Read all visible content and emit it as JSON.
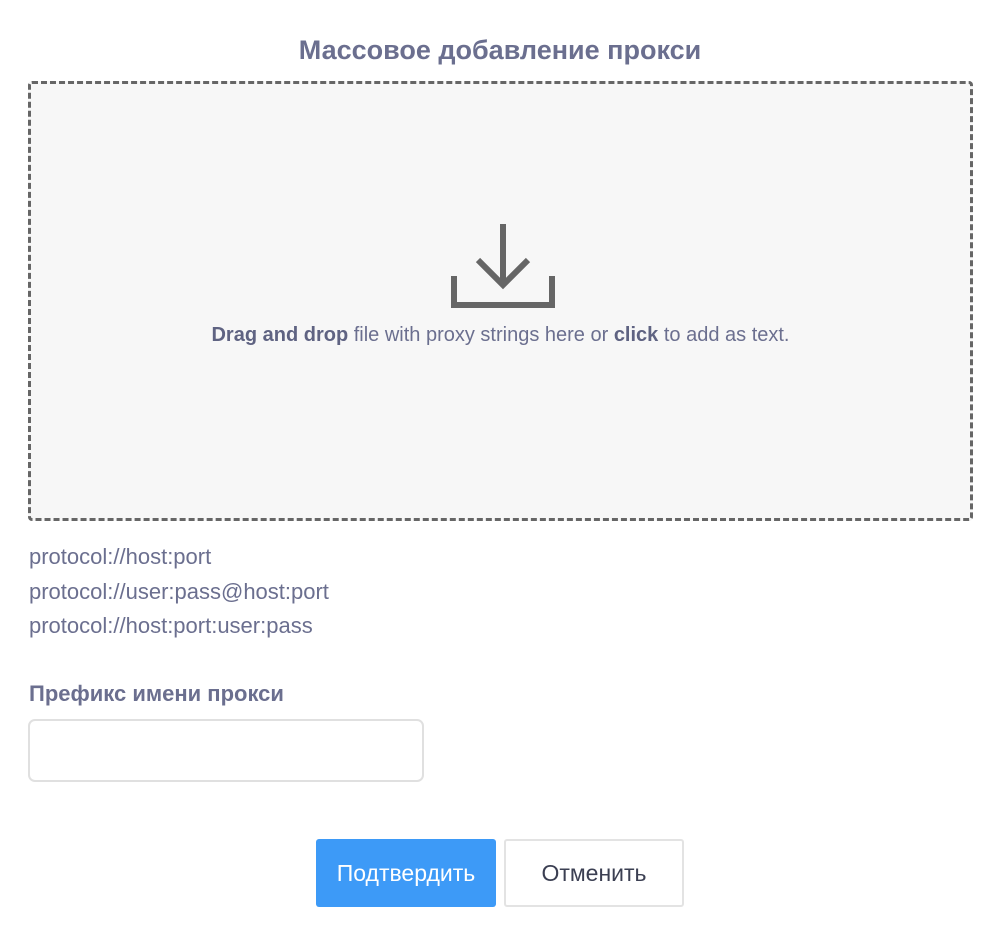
{
  "dialog": {
    "title": "Массовое добавление прокси"
  },
  "dropzone": {
    "icon": "download-icon",
    "text_bold_1": "Drag and drop",
    "text_mid": " file with proxy strings here or ",
    "text_bold_2": "click",
    "text_end": " to add as text."
  },
  "formats": [
    "protocol://host:port",
    "protocol://user:pass@host:port",
    "protocol://host:port:user:pass"
  ],
  "prefix": {
    "label": "Префикс имени прокси",
    "value": "",
    "placeholder": ""
  },
  "buttons": {
    "confirm_label": "Подтвердить",
    "cancel_label": "Отменить"
  },
  "colors": {
    "accent": "#3d9af7",
    "text_muted": "#6b6f8f",
    "dropzone_bg": "#f7f7f7",
    "dropzone_border": "#666666"
  }
}
